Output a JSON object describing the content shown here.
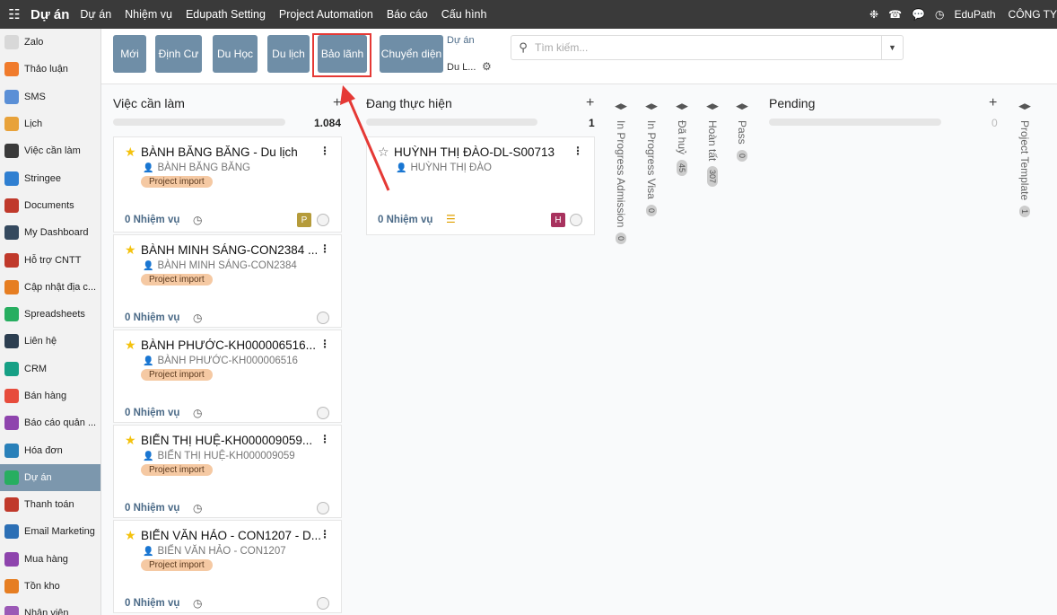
{
  "topbar": {
    "brand": "Dự án",
    "menu": [
      "Dự án",
      "Nhiệm vụ",
      "Edupath Setting",
      "Project Automation",
      "Báo cáo",
      "Cấu hình"
    ],
    "company": "EduPath",
    "company2": "CÔNG TY"
  },
  "sidebar": {
    "items": [
      {
        "label": "Zalo",
        "color": "#d8d8d8"
      },
      {
        "label": "Thảo luận",
        "color": "#f07b2c"
      },
      {
        "label": "SMS",
        "color": "#5a8fd6"
      },
      {
        "label": "Lịch",
        "color": "#e8a23a"
      },
      {
        "label": "Việc cần làm",
        "color": "#3a3a3a"
      },
      {
        "label": "Stringee",
        "color": "#2f7fd1"
      },
      {
        "label": "Documents",
        "color": "#c0392b"
      },
      {
        "label": "My Dashboard",
        "color": "#34495e"
      },
      {
        "label": "Hỗ trợ CNTT",
        "color": "#c0392b"
      },
      {
        "label": "Cập nhật địa c...",
        "color": "#e67e22"
      },
      {
        "label": "Spreadsheets",
        "color": "#27ae60"
      },
      {
        "label": "Liên hệ",
        "color": "#2c3e50"
      },
      {
        "label": "CRM",
        "color": "#16a085"
      },
      {
        "label": "Bán hàng",
        "color": "#e74c3c"
      },
      {
        "label": "Báo cáo quản ...",
        "color": "#8e44ad"
      },
      {
        "label": "Hóa đơn",
        "color": "#2980b9"
      },
      {
        "label": "Dự án",
        "color": "#27ae60"
      },
      {
        "label": "Thanh toán",
        "color": "#c0392b"
      },
      {
        "label": "Email Marketing",
        "color": "#2c6fb5"
      },
      {
        "label": "Mua hàng",
        "color": "#8e44ad"
      },
      {
        "label": "Tồn kho",
        "color": "#e67e22"
      },
      {
        "label": "Nhân viên",
        "color": "#9b59b6"
      }
    ]
  },
  "control": {
    "buttons": [
      "Mới",
      "Định Cư",
      "Du Học",
      "Du lịch",
      "Bảo lãnh",
      "Chuyển diện"
    ],
    "breadcrumb": "Dự án",
    "breadcrumb_current": "Du L...",
    "search_placeholder": "Tìm kiếm..."
  },
  "columns": {
    "todo": {
      "title": "Việc cần làm",
      "count": "1.084"
    },
    "inprogress": {
      "title": "Đang thực hiện",
      "count": "1"
    },
    "pending": {
      "title": "Pending",
      "count": "0"
    }
  },
  "cards_todo": [
    {
      "title": "BÀNH BĂNG BĂNG - Du lịch",
      "person": "BÀNH BĂNG BĂNG",
      "tag": "Project import",
      "tasks_count": "0",
      "tasks_label": "Nhiệm vụ",
      "avatar": "P",
      "avatar_color": "#b59b3a"
    },
    {
      "title": "BÀNH MINH SÁNG-CON2384 ...",
      "person": "BÀNH MINH SÁNG-CON2384",
      "tag": "Project import",
      "tasks_count": "0",
      "tasks_label": "Nhiệm vụ"
    },
    {
      "title": "BÀNH PHƯỚC-KH000006516...",
      "person": "BÀNH PHƯỚC-KH000006516",
      "tag": "Project import",
      "tasks_count": "0",
      "tasks_label": "Nhiệm vụ"
    },
    {
      "title": "BIỂN THỊ HUỆ-KH000009059...",
      "person": "BIỂN THỊ HUỆ-KH000009059",
      "tag": "Project import",
      "tasks_count": "0",
      "tasks_label": "Nhiệm vụ"
    },
    {
      "title": "BIỂN VĂN HẢO - CON1207 - D...",
      "person": "BIỂN VĂN HẢO - CON1207",
      "tag": "Project import",
      "tasks_count": "0",
      "tasks_label": "Nhiệm vụ"
    }
  ],
  "card_inprogress": {
    "title": "HUỲNH THỊ ĐÀO-DL-S00713",
    "person": "HUỲNH THỊ ĐÀO",
    "tasks_count": "0",
    "tasks_label": "Nhiệm vụ",
    "avatar": "H",
    "avatar_color": "#a8325e"
  },
  "folded": [
    {
      "label": "In Progress Admission",
      "count": "0"
    },
    {
      "label": "In Progress Visa",
      "count": "0"
    },
    {
      "label": "Đã huỷ",
      "count": "45"
    },
    {
      "label": "Hoàn tất",
      "count": "307"
    },
    {
      "label": "Pass",
      "count": "0"
    },
    {
      "label": "Project Template",
      "count": "1"
    }
  ]
}
